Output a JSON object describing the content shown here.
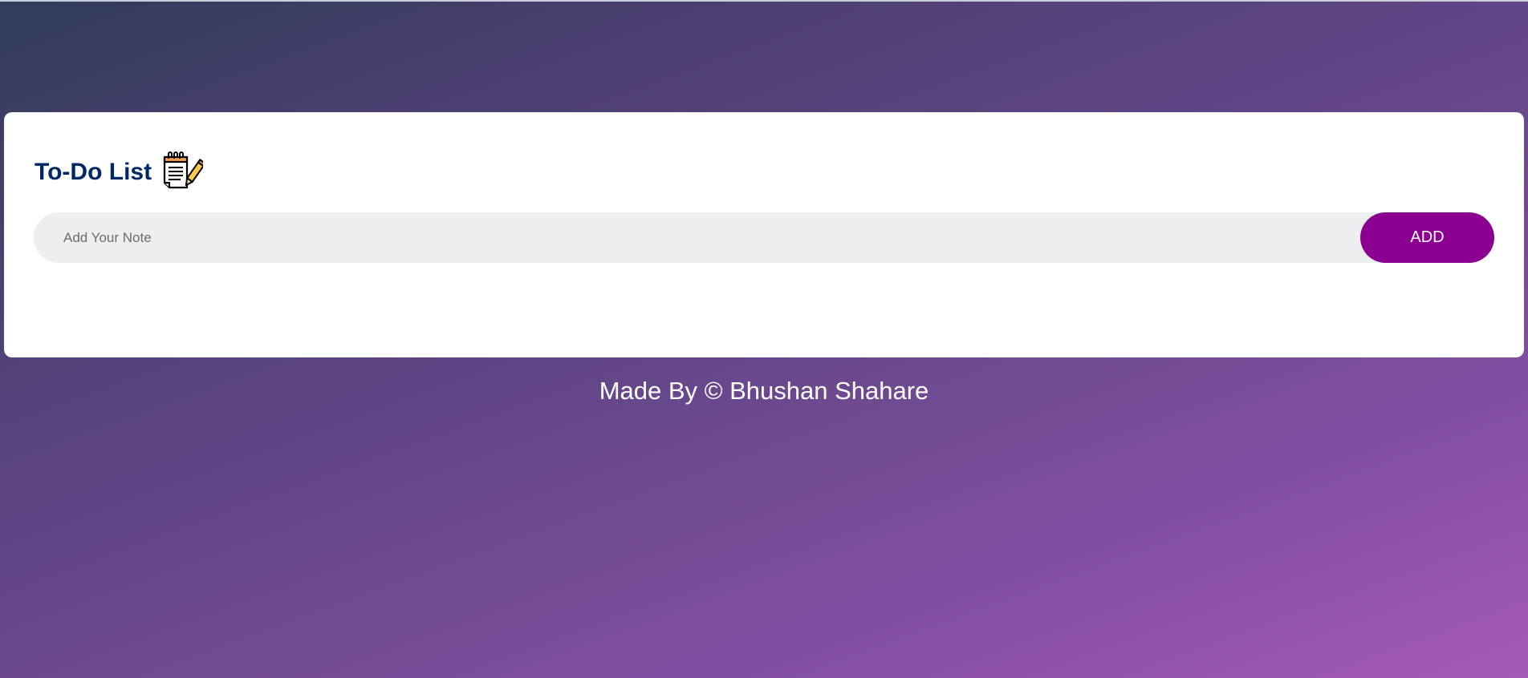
{
  "app": {
    "title": "To-Do List",
    "title_icon": "notepad-pencil-icon"
  },
  "input": {
    "value": "",
    "placeholder": "Add Your Note"
  },
  "add_button": {
    "label": "ADD"
  },
  "footer": {
    "text": "Made By © Bhushan Shahare"
  },
  "colors": {
    "title": "#002765",
    "accent": "#8b0090",
    "input_bg": "#edeef0",
    "card_bg": "#ffffff",
    "gradient_start": "#2f3c5a",
    "gradient_end": "#a45ab8"
  }
}
